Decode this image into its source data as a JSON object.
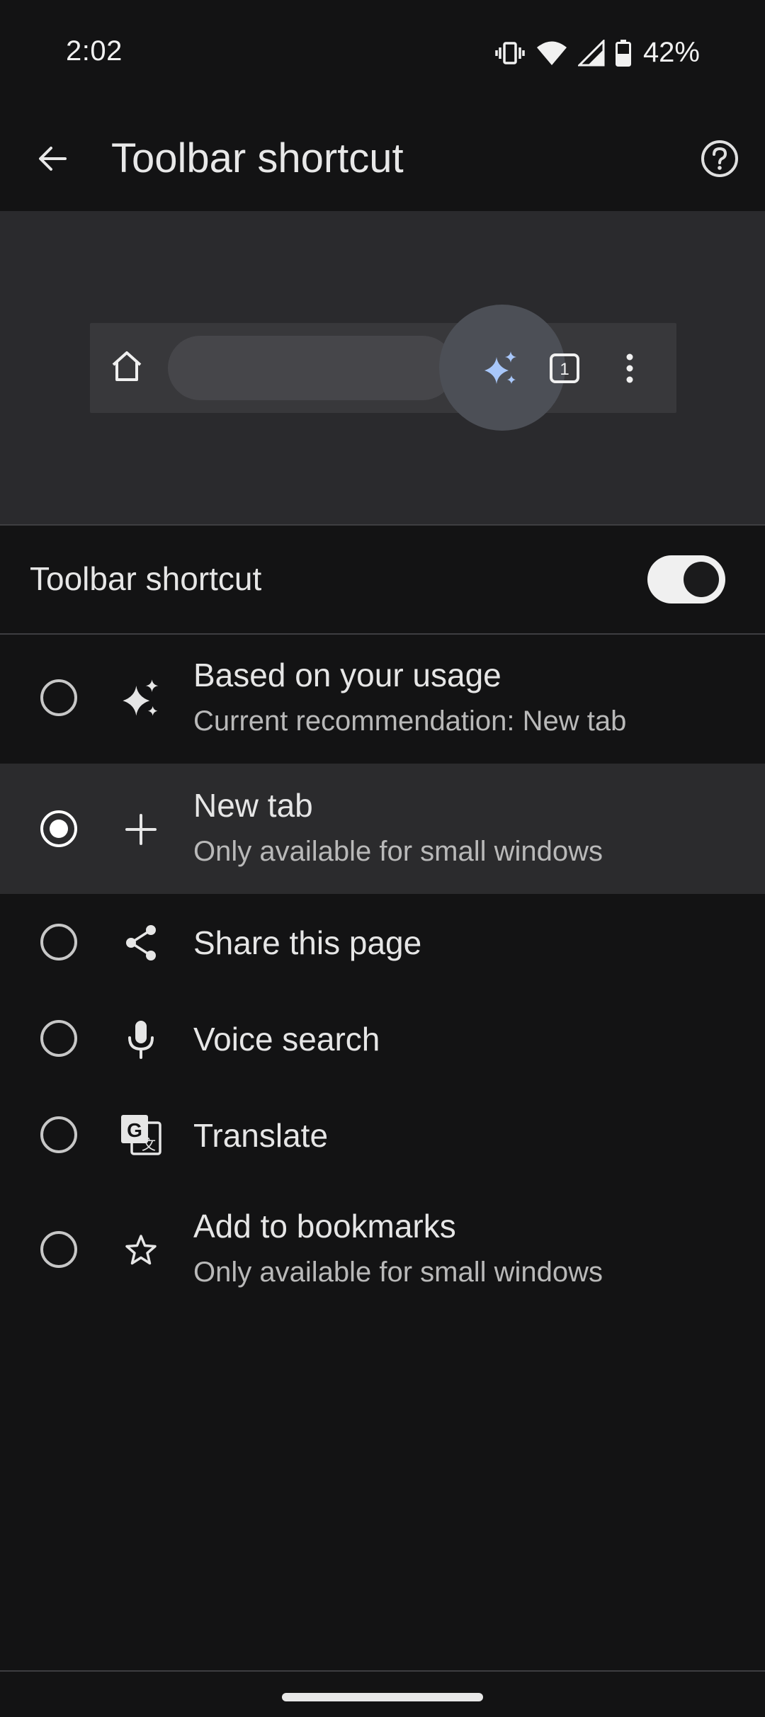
{
  "status_bar": {
    "time": "2:02",
    "battery_percent": "42%",
    "icons": [
      "vibrate-icon",
      "wifi-icon",
      "signal-icon",
      "battery-icon"
    ]
  },
  "app_bar": {
    "title": "Toolbar shortcut",
    "back_icon": "back-arrow-icon",
    "help_icon": "help-icon"
  },
  "preview": {
    "tab_count": "1",
    "shortcut_icon": "sparkle-icon",
    "accent": "#a8c7fa"
  },
  "toggle": {
    "label": "Toolbar shortcut",
    "enabled": true
  },
  "options": [
    {
      "title": "Based on your usage",
      "subtitle": "Current recommendation:  New tab",
      "icon": "sparkle-icon",
      "selected": false
    },
    {
      "title": "New tab",
      "subtitle": "Only available for small windows",
      "icon": "plus-icon",
      "selected": true
    },
    {
      "title": "Share this page",
      "subtitle": "",
      "icon": "share-icon",
      "selected": false
    },
    {
      "title": "Voice search",
      "subtitle": "",
      "icon": "mic-icon",
      "selected": false
    },
    {
      "title": "Translate",
      "subtitle": "",
      "icon": "translate-icon",
      "selected": false
    },
    {
      "title": "Add to bookmarks",
      "subtitle": "Only available for small windows",
      "icon": "star-icon",
      "selected": false
    }
  ],
  "colors": {
    "background": "#131314",
    "preview_background": "#2a2a2d",
    "selected_row": "#2b2b2d",
    "text": "#e6e6e6"
  }
}
